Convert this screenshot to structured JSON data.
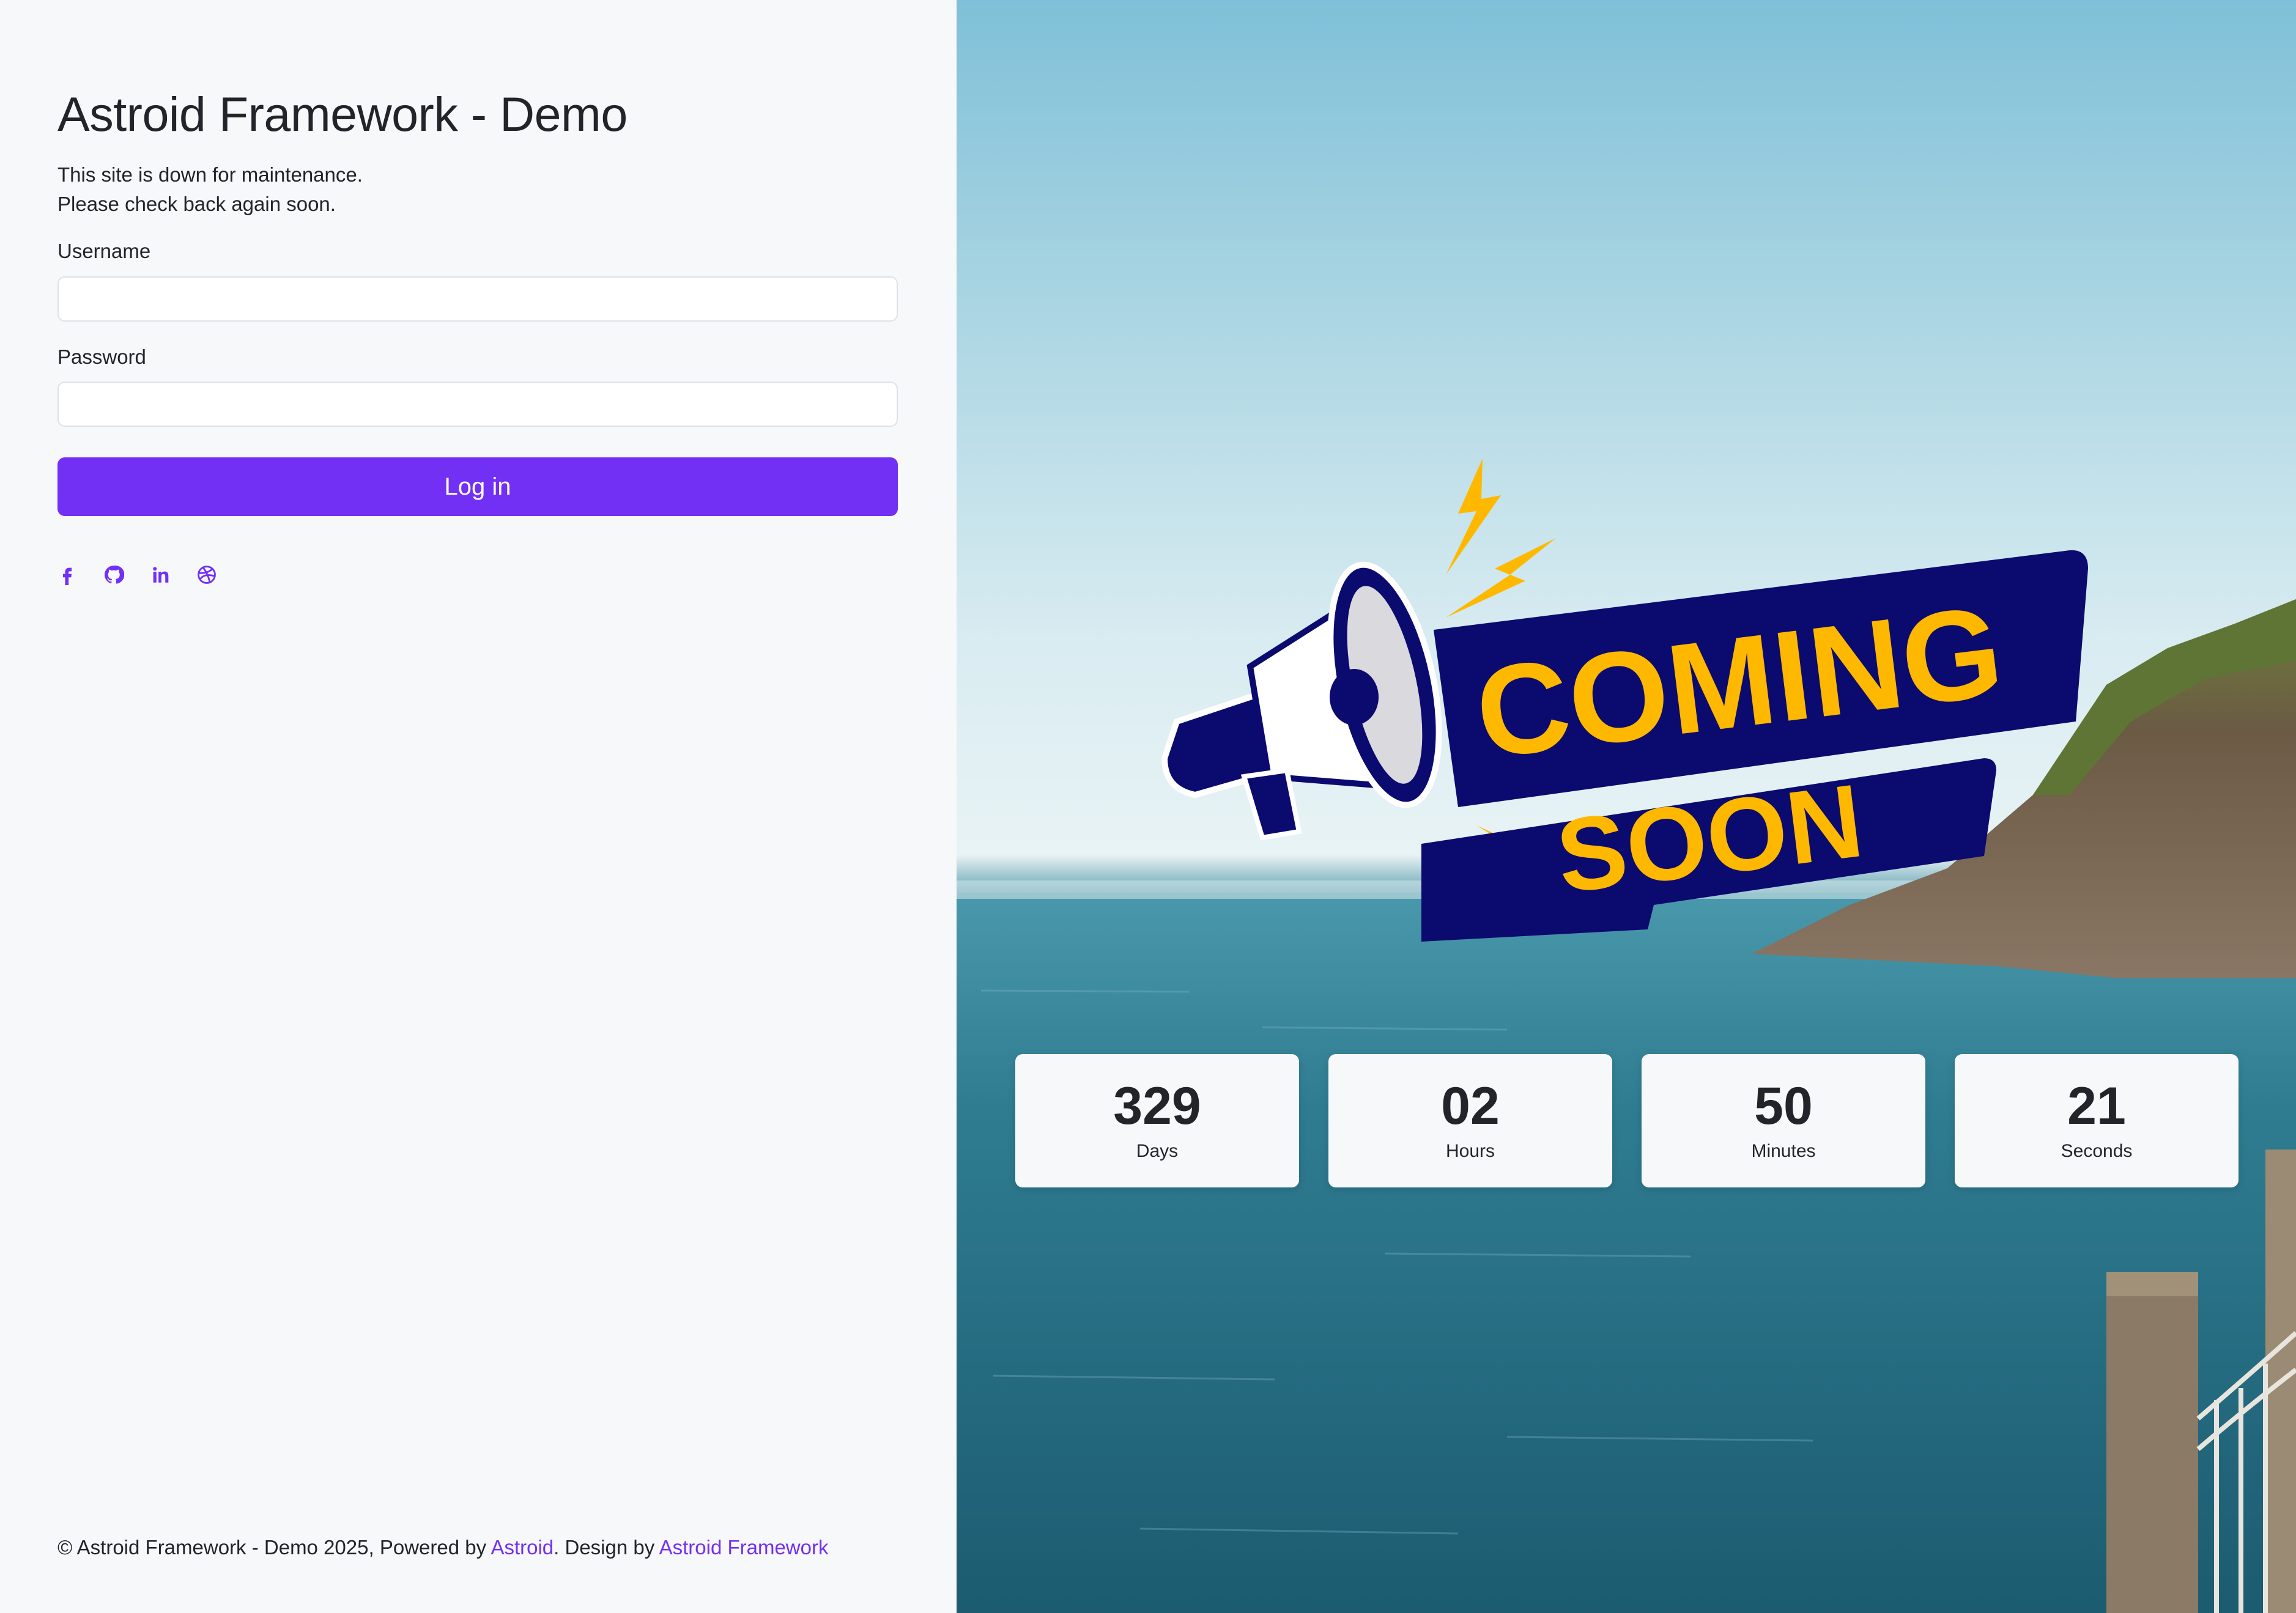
{
  "site": {
    "title": "Astroid Framework - Demo",
    "message_line1": "This site is down for maintenance.",
    "message_line2": "Please check back again soon."
  },
  "login": {
    "username_label": "Username",
    "username_value": "",
    "password_label": "Password",
    "password_value": "",
    "submit_label": "Log in"
  },
  "socials": [
    {
      "name": "facebook-icon"
    },
    {
      "name": "github-icon"
    },
    {
      "name": "linkedin-icon"
    },
    {
      "name": "dribbble-icon"
    }
  ],
  "footer": {
    "prefix": "© Astroid Framework - Demo 2025, Powered by ",
    "link1": "Astroid",
    "middle": ". Design by ",
    "link2": "Astroid Framework"
  },
  "banner": {
    "line1": "COMING",
    "line2": "SOON"
  },
  "countdown": [
    {
      "value": "329",
      "label": "Days"
    },
    {
      "value": "02",
      "label": "Hours"
    },
    {
      "value": "50",
      "label": "Minutes"
    },
    {
      "value": "21",
      "label": "Seconds"
    }
  ],
  "colors": {
    "accent": "#7230f5",
    "banner_navy": "#0b0a6f",
    "banner_yellow": "#ffb800",
    "panel_bg": "#f7f8fa"
  }
}
